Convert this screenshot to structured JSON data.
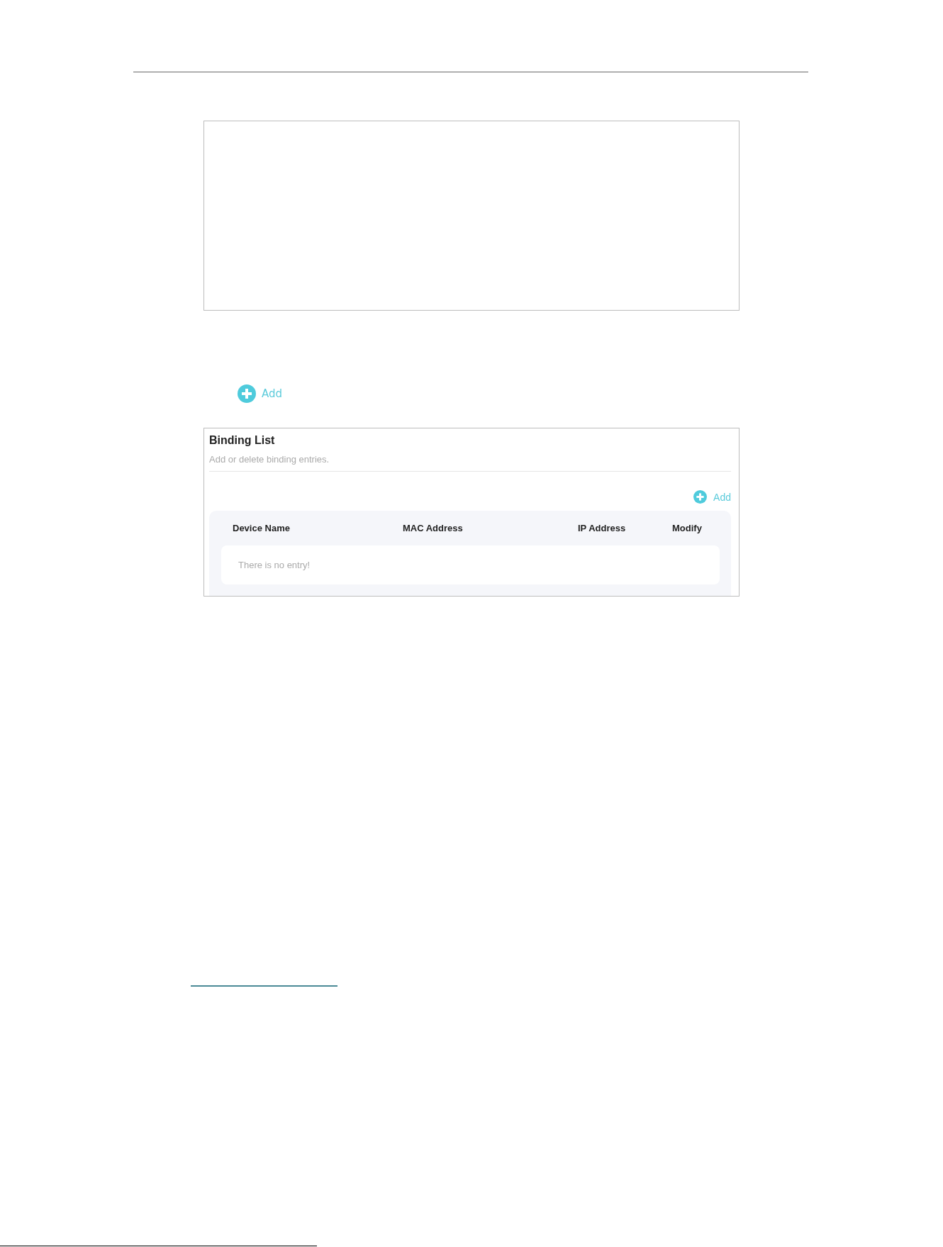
{
  "add_button": {
    "label": "Add"
  },
  "binding_list": {
    "title": "Binding List",
    "subtitle": "Add or delete binding entries.",
    "add_button": {
      "label": "Add"
    },
    "table": {
      "columns": [
        "Device Name",
        "MAC Address",
        "IP Address",
        "Modify"
      ],
      "empty_message": "There is no entry!"
    }
  }
}
